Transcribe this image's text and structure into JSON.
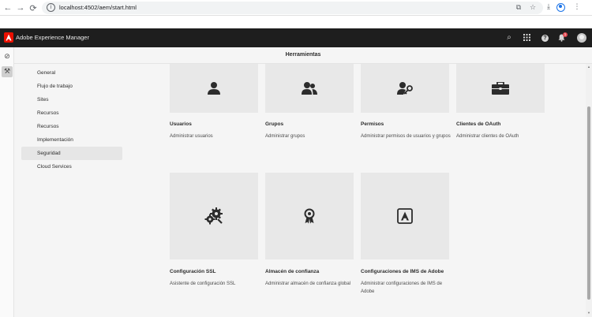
{
  "browser": {
    "url": "localhost:4502/aem/start.html",
    "back": "←",
    "forward": "→",
    "reload": "⟳",
    "info": "i",
    "translate": "⧉",
    "star": "☆",
    "download": "⤓",
    "menu": "⋮"
  },
  "shell": {
    "app_title": "Adobe Experience Manager",
    "search_icon": "⌕",
    "solutions_icon": "⋯",
    "help": "?",
    "notifications_icon": "🔔",
    "notifications_count": "1"
  },
  "rail": {
    "items": [
      {
        "icon": "⊘",
        "name": "navigation-icon"
      },
      {
        "icon": "⚒",
        "name": "tools-icon"
      }
    ]
  },
  "header": {
    "title": "Herramientas"
  },
  "nav": {
    "items": [
      {
        "label": "General"
      },
      {
        "label": "Flujo de trabajo"
      },
      {
        "label": "Sites"
      },
      {
        "label": "Recursos"
      },
      {
        "label": "Recursos"
      },
      {
        "label": "Implementación"
      },
      {
        "label": "Seguridad",
        "selected": true
      },
      {
        "label": "Cloud Services"
      }
    ]
  },
  "cards": [
    {
      "title": "Usuarios",
      "description": "Administrar usuarios",
      "icon": "user-icon"
    },
    {
      "title": "Grupos",
      "description": "Administrar grupos",
      "icon": "users-icon"
    },
    {
      "title": "Permisos",
      "description": "Administrar permisos de usuarios y grupos",
      "icon": "user-key-icon"
    },
    {
      "title": "Clientes de OAuth",
      "description": "Administrar clientes de OAuth",
      "icon": "briefcase-icon"
    },
    {
      "title": "Configuración SSL",
      "description": "Asistente de configuración SSL",
      "icon": "gears-icon"
    },
    {
      "title": "Almacén de confianza",
      "description": "Administrar almacén de confianza global",
      "icon": "award-icon"
    },
    {
      "title": "Configuraciones de IMS de Adobe",
      "description": "Administrar configuraciones de IMS de Adobe",
      "icon": "adobe-icon"
    }
  ],
  "colors": {
    "shell_bg": "#1e1e1e",
    "adobe_red": "#eb1000",
    "content_bg": "#f5f5f5",
    "tile_bg": "#e8e8e8",
    "notification_badge": "#e34850"
  }
}
